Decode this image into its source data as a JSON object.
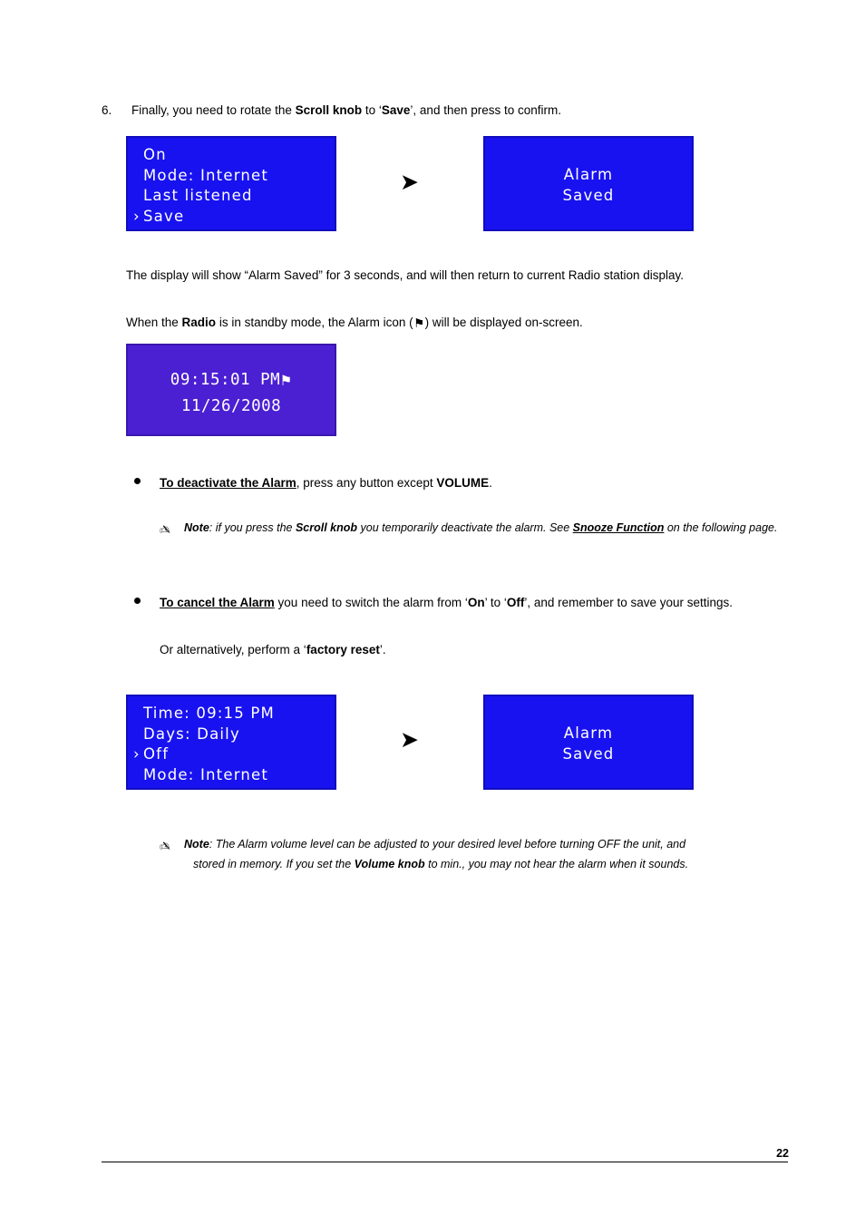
{
  "step": {
    "number": "6.",
    "text_before_bold": "Finally, you need to rotate the ",
    "bold_1": "Scroll knob",
    "text_mid": " to ‘",
    "bold_2": "Save",
    "text_after": "’, and then press to confirm."
  },
  "lcd_save": {
    "line1": "On",
    "line2": "Mode: Internet",
    "line3": "Last listened",
    "line4": "Save",
    "caret": "›"
  },
  "lcd_alarm_saved": {
    "line1": "Alarm",
    "line2": "Saved"
  },
  "lcd_standby": {
    "time": "09:15:01 PM",
    "bell": "⚑",
    "date": "11/26/2008"
  },
  "lcd_time_days": {
    "line1": "Time: 09:15 PM",
    "line2": "Days: Daily",
    "line3": "Off",
    "line4": "Mode: Internet",
    "caret": "›"
  },
  "arrow_glyph": "➤",
  "paragraphs": {
    "display": "The display will show “Alarm Saved” for 3 seconds, and will then return to current Radio station display.",
    "standby_before": "When the ",
    "standby_bold": "Radio",
    "standby_mid": " is in standby mode, the Alarm icon (",
    "standby_icon": "⚑",
    "standby_after": ") will be displayed on-screen.",
    "alternative_before": "Or alternatively, perform a ‘",
    "alternative_bold": "factory reset",
    "alternative_after": "’."
  },
  "bullets": {
    "deactivate": {
      "link": "To deactivate the Alarm",
      "text_mid": ", press any button except ",
      "bold": "VOLUME",
      "text_end": "."
    },
    "cancel": {
      "link": "To cancel the Alarm",
      "text_1": " you need to switch the alarm from ‘",
      "bold_1": "On",
      "text_2": "’ to ‘",
      "bold_2": "Off",
      "text_3": "’, and remember to save your settings."
    }
  },
  "notes": {
    "icon": "✍",
    "snooze": {
      "label": "Note",
      "text_1": ": if you press the ",
      "bold_1": "Scroll knob",
      "text_2": " you temporarily deactivate the alarm. See ",
      "link": "Snooze Function",
      "text_3": " on the following page."
    },
    "volume": {
      "label": "Note",
      "text_1": ":  The Alarm volume level can be adjusted to your desired level before turning OFF the unit, and",
      "text_2": "stored in memory. If you set the ",
      "bold_1": "Volume knob",
      "text_3": " to min., you may not hear the alarm when it sounds."
    }
  },
  "footer": {
    "page_number": "22"
  }
}
